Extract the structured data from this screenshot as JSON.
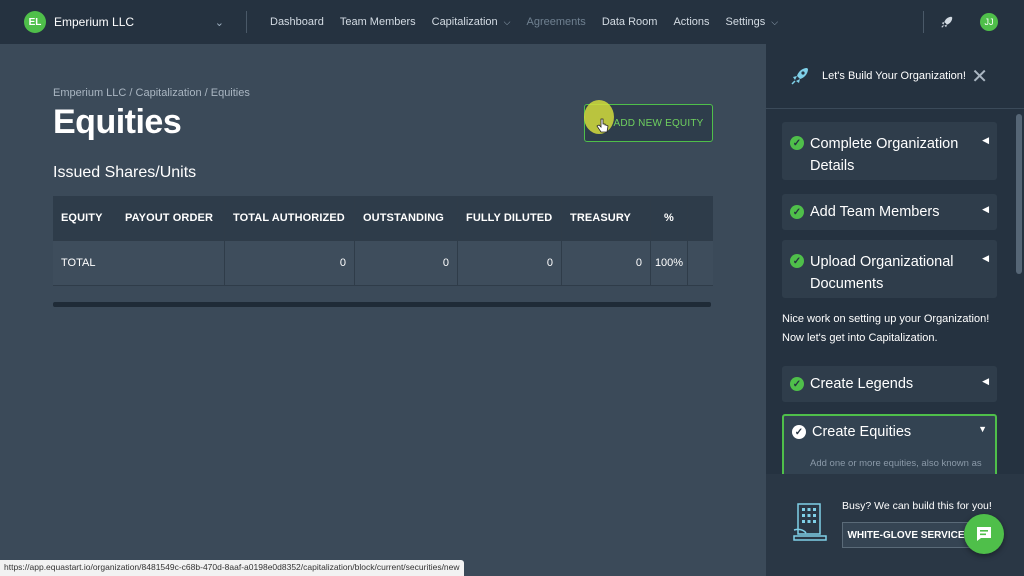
{
  "topbar": {
    "org_initials": "EL",
    "org_name": "Emperium LLC",
    "nav": [
      {
        "label": "Dashboard",
        "dropdown": false,
        "disabled": false
      },
      {
        "label": "Team Members",
        "dropdown": false,
        "disabled": false
      },
      {
        "label": "Capitalization",
        "dropdown": true,
        "disabled": false
      },
      {
        "label": "Agreements",
        "dropdown": false,
        "disabled": true
      },
      {
        "label": "Data Room",
        "dropdown": false,
        "disabled": false
      },
      {
        "label": "Actions",
        "dropdown": false,
        "disabled": false
      },
      {
        "label": "Settings",
        "dropdown": true,
        "disabled": false
      }
    ],
    "avatar_initials": "JJ"
  },
  "main": {
    "breadcrumb": "Emperium LLC / Capitalization / Equities",
    "title": "Equities",
    "add_button": "ADD NEW EQUITY",
    "section_title": "Issued Shares/Units",
    "table": {
      "headers": [
        "EQUITY",
        "PAYOUT ORDER",
        "TOTAL AUTHORIZED",
        "OUTSTANDING",
        "FULLY DILUTED",
        "TREASURY",
        "%"
      ],
      "rows": [
        [
          "TOTAL",
          "",
          "0",
          "0",
          "0",
          "0",
          "100%"
        ]
      ]
    }
  },
  "status_url": "https://app.equastart.io/organization/8481549c-c68b-470d-8aaf-a0198e0d8352/capitalization/block/current/securities/new",
  "panel": {
    "title": "Let's Build Your Organization!",
    "steps": [
      {
        "label": "Complete Organization Details"
      },
      {
        "label": "Add Team Members"
      },
      {
        "label": "Upload Organizational Documents"
      }
    ],
    "message": "Nice work on setting up your Organization! Now let's get into Capitalization.",
    "steps2": [
      {
        "label": "Create Legends"
      },
      {
        "label": "Create Equities",
        "sub": "Add one or more equities, also known as"
      }
    ],
    "busy_text": "Busy? We can build this for you!",
    "white_glove_button": "WHITE-GLOVE SERVICE"
  },
  "colors": {
    "accent": "#4fbf4a",
    "background": "#3b4a59",
    "topbar": "#253240"
  },
  "icons": {
    "org_chevron": "chevron-down-icon",
    "rocket": "rocket-icon",
    "close": "close-icon",
    "check": "check-circle-icon",
    "chat": "chat-icon",
    "building": "building-icon"
  }
}
